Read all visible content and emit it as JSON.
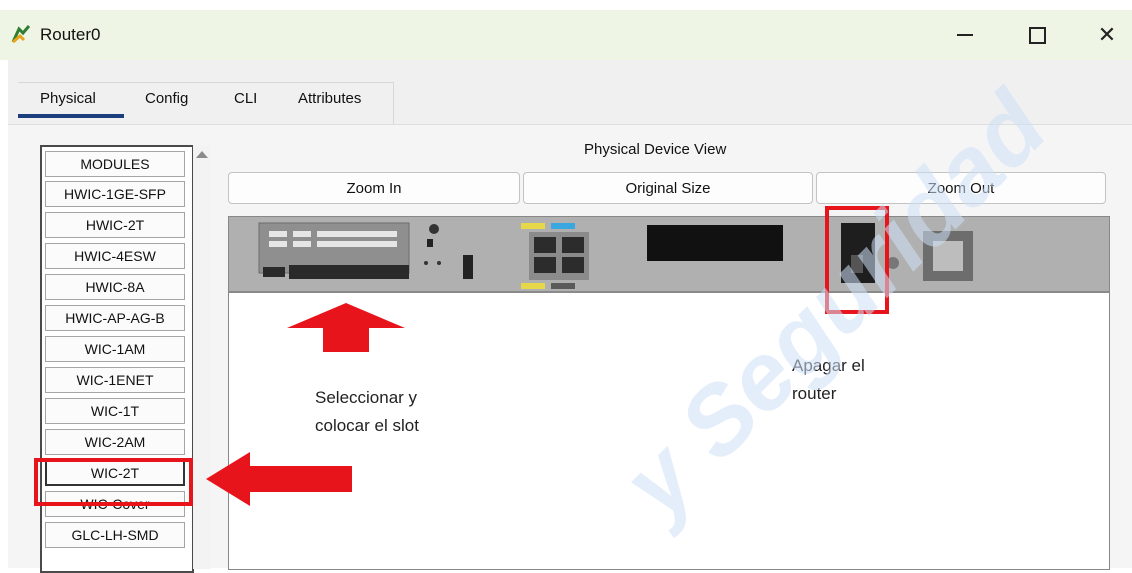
{
  "window": {
    "title": "Router0",
    "icon": "router-app-icon"
  },
  "tabs": [
    {
      "label": "Physical",
      "active": true
    },
    {
      "label": "Config",
      "active": false
    },
    {
      "label": "CLI",
      "active": false
    },
    {
      "label": "Attributes",
      "active": false
    }
  ],
  "modules": [
    "MODULES",
    "HWIC-1GE-SFP",
    "HWIC-2T",
    "HWIC-4ESW",
    "HWIC-8A",
    "HWIC-AP-AG-B",
    "WIC-1AM",
    "WIC-1ENET",
    "WIC-1T",
    "WIC-2AM",
    "WIC-2T",
    "WIC-Cover",
    "GLC-LH-SMD"
  ],
  "selected_module": "WIC-2T",
  "device_view": {
    "title": "Physical Device View",
    "zoom_in": "Zoom In",
    "original_size": "Original Size",
    "zoom_out": "Zoom Out"
  },
  "annotations": {
    "slot_line1": "Seleccionar y",
    "slot_line2": "colocar el slot",
    "power_line1": "Apagar el",
    "power_line2": "router"
  },
  "watermark": "y Seguridad",
  "colors": {
    "highlight_red": "#e8141b",
    "tab_underline": "#1b3f7c",
    "title_bar": "#eef5e4",
    "watermark": "#cfe1f7"
  }
}
